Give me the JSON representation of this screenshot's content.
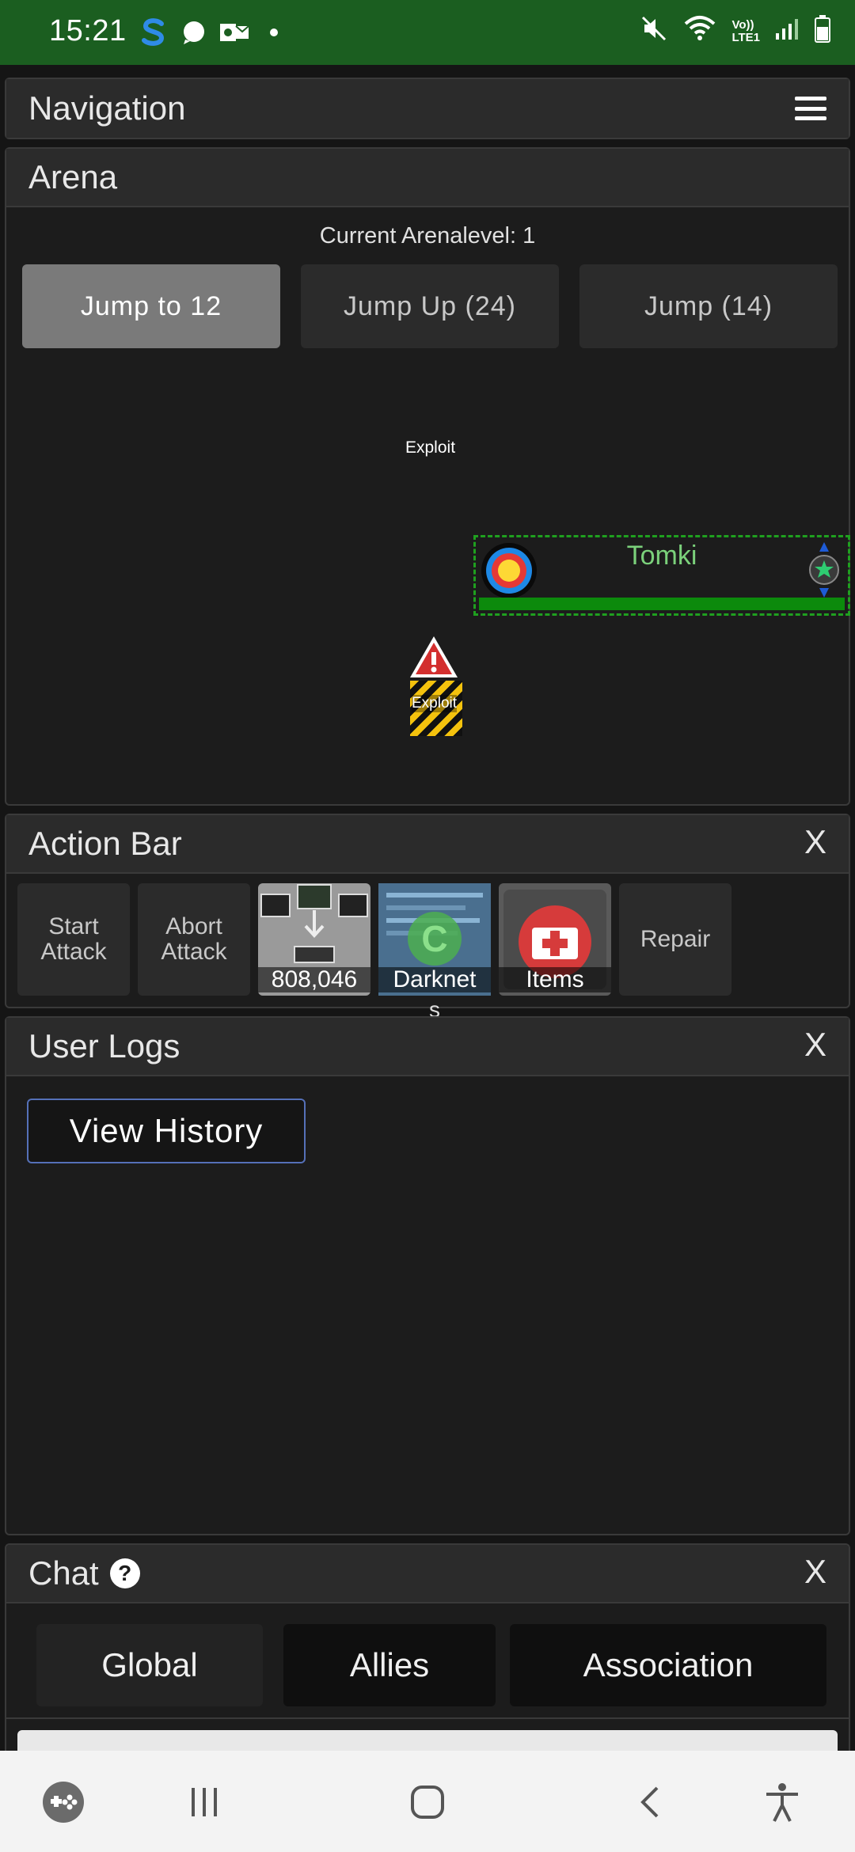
{
  "status_bar": {
    "time": "15:21",
    "left_icons": [
      "s-app-icon",
      "chat-bubble-icon",
      "outlook-icon",
      "dot-icon"
    ],
    "right_icons": [
      "mute-icon",
      "wifi-icon",
      "volte-icon",
      "signal-icon",
      "battery-icon"
    ],
    "volte_text": "Vo))\nLTE1"
  },
  "navigation": {
    "title": "Navigation"
  },
  "arena": {
    "title": "Arena",
    "level_text": "Current Arenalevel: 1",
    "buttons": [
      "Jump to 12",
      "Jump Up (24)",
      "Jump (14)"
    ],
    "exploit_top": "Exploit",
    "exploit_bottom": "Exploit",
    "target_name": "Tomki"
  },
  "action_bar": {
    "title": "Action Bar",
    "close": "X",
    "tiles": {
      "start_attack": "Start Attack",
      "abort_attack": "Abort Attack",
      "network_count": "808,046",
      "darknet_label": "Darknet",
      "darknet_overflow": "s",
      "items_label": "Items",
      "repair": "Repair"
    }
  },
  "user_logs": {
    "title": "User Logs",
    "close": "X",
    "view_history": "View History"
  },
  "chat": {
    "title": "Chat",
    "help": "?",
    "close": "X",
    "tabs": [
      "Global",
      "Allies",
      "Association"
    ]
  },
  "colors": {
    "status_bar": "#1b5e20",
    "target_green": "#1fa01f",
    "hp_bar": "#0c8a0c",
    "view_history_border": "#5570b8"
  }
}
